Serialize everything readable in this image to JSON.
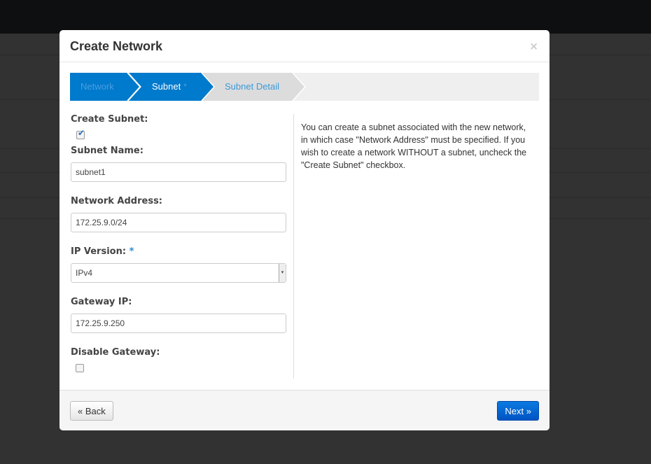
{
  "modal": {
    "title": "Create Network",
    "close": "×"
  },
  "steps": [
    {
      "label": "Network",
      "state": "done"
    },
    {
      "label": "Subnet",
      "required": "*",
      "state": "active"
    },
    {
      "label": "Subnet Detail",
      "state": "pending"
    }
  ],
  "form": {
    "create_subnet": {
      "label": "Create Subnet:",
      "checked": true
    },
    "subnet_name": {
      "label": "Subnet Name:",
      "value": "subnet1"
    },
    "network_address": {
      "label": "Network Address:",
      "value": "172.25.9.0/24"
    },
    "ip_version": {
      "label": "IP Version:",
      "required": "*",
      "value": "IPv4"
    },
    "gateway_ip": {
      "label": "Gateway IP:",
      "value": "172.25.9.250"
    },
    "disable_gateway": {
      "label": "Disable Gateway:",
      "checked": false
    }
  },
  "help": "You can create a subnet associated with the new network, in which case \"Network Address\" must be specified. If you wish to create a network WITHOUT a subnet, uncheck the \"Create Subnet\" checkbox.",
  "footer": {
    "back": "« Back",
    "next": "Next »"
  },
  "colors": {
    "accent": "#007acc",
    "primary": "#0065d0"
  }
}
